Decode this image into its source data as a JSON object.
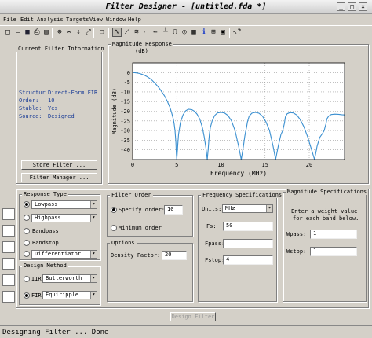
{
  "window": {
    "title": "Filter Designer - [untitled.fda *]"
  },
  "menu": [
    "File",
    "Edit",
    "Analysis",
    "Targets",
    "View",
    "Window",
    "Help"
  ],
  "toolbar": {
    "icons": [
      "new-file-icon",
      "open-folder-icon",
      "save-icon",
      "print-icon",
      "print-preview-icon",
      "zoom-in-icon",
      "zoom-x-icon",
      "zoom-y-icon",
      "full-view-icon",
      "copy-icon",
      "magnitude-icon",
      "phase-icon",
      "magnitude-phase-icon",
      "group-delay-icon",
      "phase-delay-icon",
      "impulse-response-icon",
      "step-response-icon",
      "pole-zero-icon",
      "coefficients-icon",
      "information-icon",
      "quantization-icon",
      "export-icon",
      "whats-this-icon"
    ]
  },
  "current_filter": {
    "title": "Current Filter Information",
    "rows": [
      {
        "label": "Structur",
        "value": "Direct-Form FIR"
      },
      {
        "label": "Order:",
        "value": "10"
      },
      {
        "label": "Stable:",
        "value": "Yes"
      },
      {
        "label": "Source:",
        "value": "Designed"
      }
    ],
    "store_button": "Store Filter ...",
    "manager_button": "Filter Manager ..."
  },
  "magnitude": {
    "title": "Magnitude Response",
    "subtitle": "(dB)",
    "chart_data": {
      "type": "line",
      "title": "",
      "xlabel": "Frequency (MHz)",
      "ylabel": "Magnitude (dB)",
      "xlim": [
        0,
        24
      ],
      "ylim": [
        -45,
        5
      ],
      "grid": true,
      "xticks": [
        0,
        5,
        10,
        15,
        20
      ],
      "yticks": [
        0,
        -5,
        -10,
        -15,
        -20,
        -25,
        -30,
        -35,
        -40
      ],
      "series": [
        {
          "color": "#3a8fd0",
          "x": [
            0,
            0.2,
            0.5,
            0.8,
            1.0,
            1.3,
            1.6,
            1.9,
            2.2,
            2.4,
            2.7,
            3.0,
            3.3,
            3.6,
            3.9,
            4.2,
            4.4,
            4.6,
            4.7,
            4.8,
            4.9,
            4.95,
            5.0,
            5.1,
            5.2,
            5.4,
            5.7,
            6.0,
            6.3,
            6.7,
            7.0,
            7.3,
            7.6,
            7.9,
            8.1,
            8.3,
            8.45,
            8.55,
            8.65,
            8.7,
            8.8,
            9.0,
            9.3,
            9.6,
            10.0,
            10.4,
            10.8,
            11.2,
            11.6,
            12.0,
            12.3,
            12.55,
            12.7,
            12.8,
            12.9,
            13.0,
            13.2,
            13.5,
            13.9,
            14.3,
            14.7,
            15.1,
            15.5,
            15.9,
            16.2,
            16.5,
            16.8,
            17.0,
            17.1,
            17.2,
            17.3,
            17.5,
            17.8,
            18.2,
            18.6,
            19.0,
            19.4,
            19.8,
            20.2,
            20.6,
            20.9,
            21.2,
            21.5,
            21.7,
            21.8,
            21.9,
            22.0,
            22.2,
            22.5,
            22.9,
            23.3,
            23.7,
            24.0
          ],
          "y": [
            0,
            -0.05,
            -0.2,
            -0.5,
            -0.8,
            -1.3,
            -2.0,
            -2.9,
            -4.0,
            -4.9,
            -6.4,
            -8.0,
            -9.9,
            -12.0,
            -14.6,
            -17.8,
            -20.5,
            -24.0,
            -26.5,
            -30.0,
            -36.0,
            -42.0,
            -45.0,
            -38.0,
            -32.0,
            -26.0,
            -22.0,
            -19.8,
            -19.0,
            -19.2,
            -20.0,
            -21.5,
            -24.0,
            -28.5,
            -33.0,
            -39.0,
            -45.0,
            -40.0,
            -34.0,
            -31.5,
            -28.5,
            -25.0,
            -22.2,
            -20.9,
            -20.6,
            -20.9,
            -22.2,
            -25.0,
            -30.0,
            -38.0,
            -45.0,
            -38.0,
            -33.0,
            -30.5,
            -28.5,
            -25.5,
            -22.5,
            -21.0,
            -20.6,
            -21.0,
            -22.5,
            -25.5,
            -30.0,
            -38.0,
            -45.0,
            -38.0,
            -32.0,
            -30.0,
            -28.0,
            -26.0,
            -23.0,
            -21.3,
            -20.7,
            -20.9,
            -22.0,
            -24.5,
            -28.0,
            -33.0,
            -39.0,
            -45.0,
            -38.0,
            -33.5,
            -31.5,
            -30.0,
            -28.0,
            -26.5,
            -24.0,
            -22.5,
            -21.7,
            -21.5,
            -21.6,
            -21.8,
            -21.9
          ]
        }
      ]
    }
  },
  "response_type": {
    "title": "Response Type",
    "options": [
      {
        "label": "Lowpass",
        "selected": true,
        "combo": true
      },
      {
        "label": "Highpass",
        "selected": false,
        "combo": true
      },
      {
        "label": "Bandpass",
        "selected": false,
        "combo": false
      },
      {
        "label": "Bandstop",
        "selected": false,
        "combo": false
      },
      {
        "label": "Differentiator",
        "selected": false,
        "combo": true
      }
    ]
  },
  "design_method": {
    "title": "Design Method",
    "iir_label": "IIR",
    "iir_value": "Butterworth",
    "fir_label": "FIR",
    "fir_value": "Equiripple"
  },
  "filter_order": {
    "title": "Filter Order",
    "specify_label": "Specify order:",
    "specify_value": "10",
    "minimum_label": "Minimum order"
  },
  "options": {
    "title": "Options",
    "density_label": "Density Factor:",
    "density_value": "20"
  },
  "freq_specs": {
    "title": "Frequency Specifications",
    "units_label": "Units:",
    "units_value": "MHz",
    "fs_label": "Fs:",
    "fs_value": "50",
    "fpass_label": "Fpass:",
    "fpass_value": "1",
    "fstop_label": "Fstop:",
    "fstop_value": "4"
  },
  "mag_specs": {
    "title": "Magnitude Specifications",
    "note_line1": "Enter a weight value",
    "note_line2": "for each band below.",
    "wpass_label": "Wpass:",
    "wpass_value": "1",
    "wstop_label": "Wstop:",
    "wstop_value": "1"
  },
  "design_button": "Design Filter",
  "status": "Designing Filter ... Done"
}
